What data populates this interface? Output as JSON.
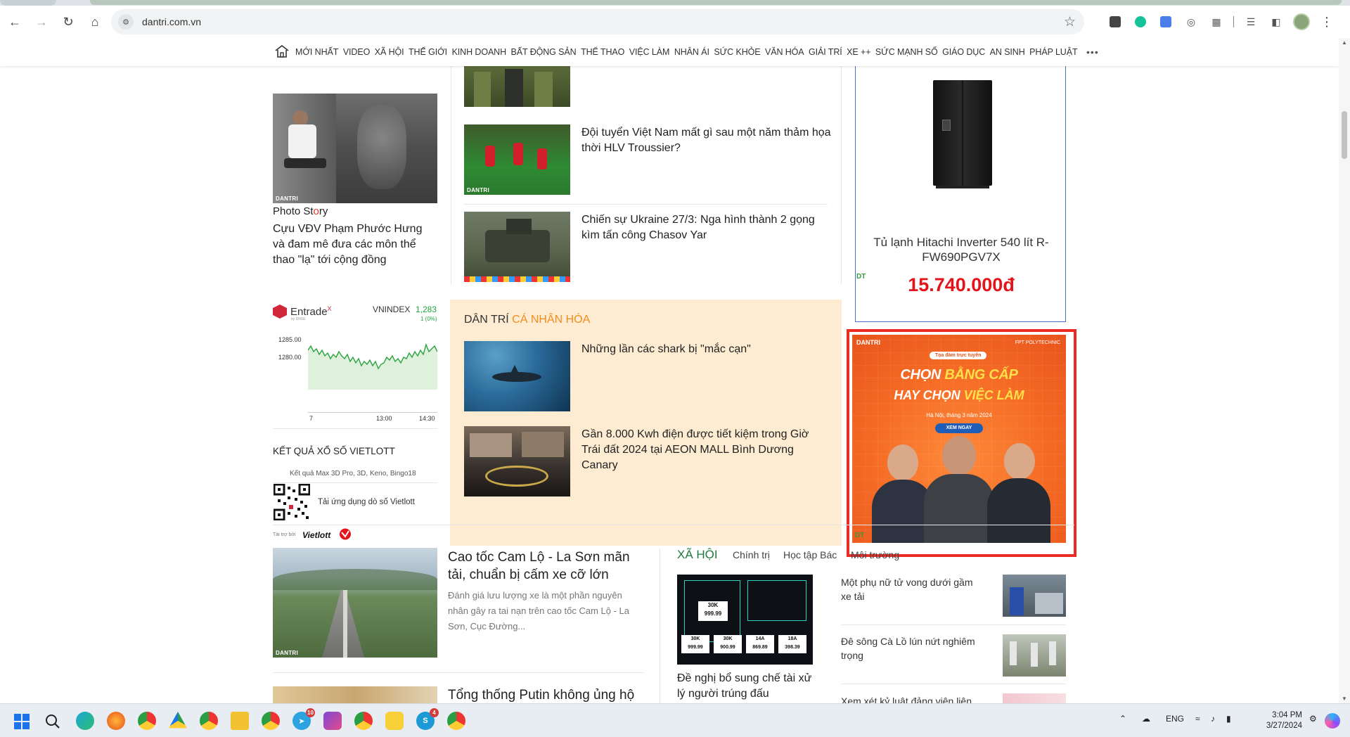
{
  "browser": {
    "url": "dantri.com.vn"
  },
  "nav": {
    "items": [
      "MỚI NHẤT",
      "VIDEO",
      "XÃ HỘI",
      "THẾ GIỚI",
      "KINH DOANH",
      "BẤT ĐỘNG SẢN",
      "THỂ THAO",
      "VIỆC LÀM",
      "NHÂN ÁI",
      "SỨC KHỎE",
      "VĂN HÓA",
      "GIẢI TRÍ",
      "XE ++",
      "SỨC MẠNH SỐ",
      "GIÁO DỤC",
      "AN SINH",
      "PHÁP LUẬT"
    ],
    "more": "•••"
  },
  "photo_story": {
    "label_pre": "Photo St",
    "label_o": "o",
    "label_post": "ry",
    "title": "Cựu VĐV Phạm Phước Hưng và đam mê đưa các môn thể thao \"lạ\" tới cộng đồng",
    "image_tag": "DANTRI"
  },
  "feed": {
    "items": [
      {
        "title": "Đội tuyển Việt Nam mất gì sau một năm thảm họa thời HLV Troussier?",
        "tag": "DANTRI"
      },
      {
        "title": "Chiến sự Ukraine 27/3: Nga hình thành 2 gọng kìm tấn công Chasov Yar",
        "tag": ""
      }
    ]
  },
  "product_ad": {
    "name": "Tủ lạnh Hitachi Inverter 540 lít R-FW690PGV7X",
    "price": "15.740.000đ",
    "mark": "DT"
  },
  "banner_ad": {
    "logo": "DANTRI",
    "partner": "FPT POLYTECHNIC",
    "pill": "Tọa đàm trực tuyến",
    "line1_pre": "CHỌN ",
    "line1_hl": "BẰNG CẤP",
    "line2_pre": "HAY CHỌN ",
    "line2_hl": "VIỆC LÀM",
    "date": "Hà Nội, tháng 3 năm 2024",
    "cta": "XEM NGAY",
    "mark": "DT",
    "accent": "#f46a24"
  },
  "stock": {
    "brand": "Entrade",
    "brand_sup": "X",
    "brand_sub": "by DNSE",
    "index_name": "VNINDEX",
    "index_value": "1,283",
    "index_change": "1 (0%)",
    "y_ticks": [
      "1285.00",
      "1280.00"
    ],
    "x_ticks": [
      "7",
      "13:00",
      "14:30"
    ]
  },
  "vietlott": {
    "heading": "KẾT QUẢ XỔ SỐ VIETLOTT",
    "subtitle": "Kết quả Max 3D Pro, 3D, Keno, Bingo18",
    "app_note": "Tải ứng dụng dò số Vietlott",
    "sponsor": "Tài trợ bởi",
    "brand": "Vietlott"
  },
  "personalized": {
    "title_pre": "DÂN TRÍ ",
    "title_acc": "CÁ NHÂN HÓA",
    "items": [
      {
        "title": "Những lần các shark bị \"mắc cạn\""
      },
      {
        "title": "Gần 8.000 Kwh điện được tiết kiệm trong Giờ Trái đất 2024 tại AEON MALL Bình Dương Canary"
      }
    ]
  },
  "lower": {
    "main_title": "Cao tốc Cam Lộ - La Sơn mãn tải, chuẩn bị cấm xe cỡ lớn",
    "main_desc": "Đánh giá lưu lượng xe là một phần nguyên nhân gây ra tai nạn trên cao tốc Cam Lộ - La Sơn, Cục Đường...",
    "main_tag": "DANTRI",
    "next_title": "Tổng thống Putin không ủng hộ",
    "section_main": "XÃ HỘI",
    "section_tabs": [
      "Chính trị",
      "Học tập Bác",
      "Môi trường"
    ],
    "plate_story_title": "Đề nghị bổ sung chế tài xử lý người trúng đấu",
    "plates": [
      "30K",
      "999.99",
      "30K",
      "999.99",
      "30K",
      "900.99",
      "14A",
      "869.89",
      "18A",
      "398.39"
    ],
    "side_items": [
      {
        "title": "Một phụ nữ tử vong dưới gầm xe tải"
      },
      {
        "title": "Đê sông Cà Lồ lún nứt nghiêm trọng"
      },
      {
        "title": "Xem xét kỷ luật đảng viên liên"
      }
    ]
  },
  "taskbar": {
    "telegram_badge": "10",
    "skype_badge": "4",
    "lang": "ENG",
    "time": "3:04 PM",
    "date": "3/27/2024"
  }
}
